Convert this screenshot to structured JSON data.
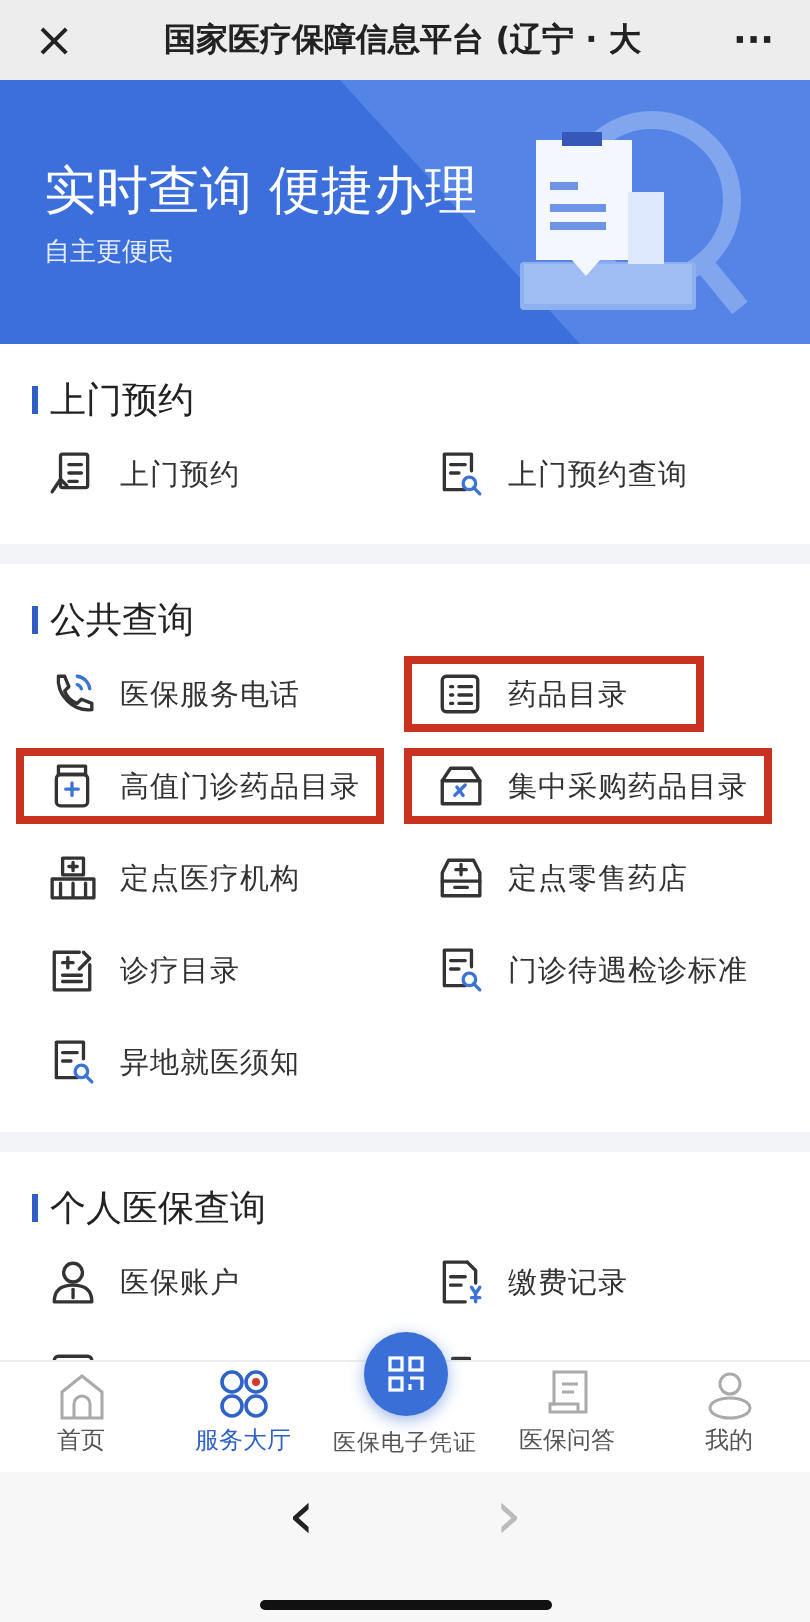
{
  "top_bar": {
    "close": "×",
    "title": "国家医疗保障信息平台 (辽宁 · 大",
    "more": "···"
  },
  "banner": {
    "title": "实时查询 便捷办理",
    "subtitle": "自主更便民"
  },
  "sections": [
    {
      "title": "上门预约",
      "items": [
        {
          "label": "上门预约",
          "highlighted": false
        },
        {
          "label": "上门预约查询",
          "highlighted": false
        }
      ]
    },
    {
      "title": "公共查询",
      "items": [
        {
          "label": "医保服务电话",
          "highlighted": false
        },
        {
          "label": "药品目录",
          "highlighted": true
        },
        {
          "label": "高值门诊药品目录",
          "highlighted": true
        },
        {
          "label": "集中采购药品目录",
          "highlighted": true
        },
        {
          "label": "定点医疗机构",
          "highlighted": false
        },
        {
          "label": "定点零售药店",
          "highlighted": false
        },
        {
          "label": "诊疗目录",
          "highlighted": false
        },
        {
          "label": "门诊待遇检诊标准",
          "highlighted": false
        },
        {
          "label": "异地就医须知",
          "highlighted": false
        }
      ]
    },
    {
      "title": "个人医保查询",
      "items": [
        {
          "label": "医保账户",
          "highlighted": false
        },
        {
          "label": "缴费记录",
          "highlighted": false
        }
      ]
    }
  ],
  "tab_bar": [
    {
      "label": "首页",
      "selected": false
    },
    {
      "label": "服务大厅",
      "selected": true
    },
    {
      "label": "医保电子凭证",
      "selected": false
    },
    {
      "label": "医保问答",
      "selected": false
    },
    {
      "label": "我的",
      "selected": false
    }
  ],
  "browser_nav": {
    "back": "‹",
    "forward": "›"
  }
}
